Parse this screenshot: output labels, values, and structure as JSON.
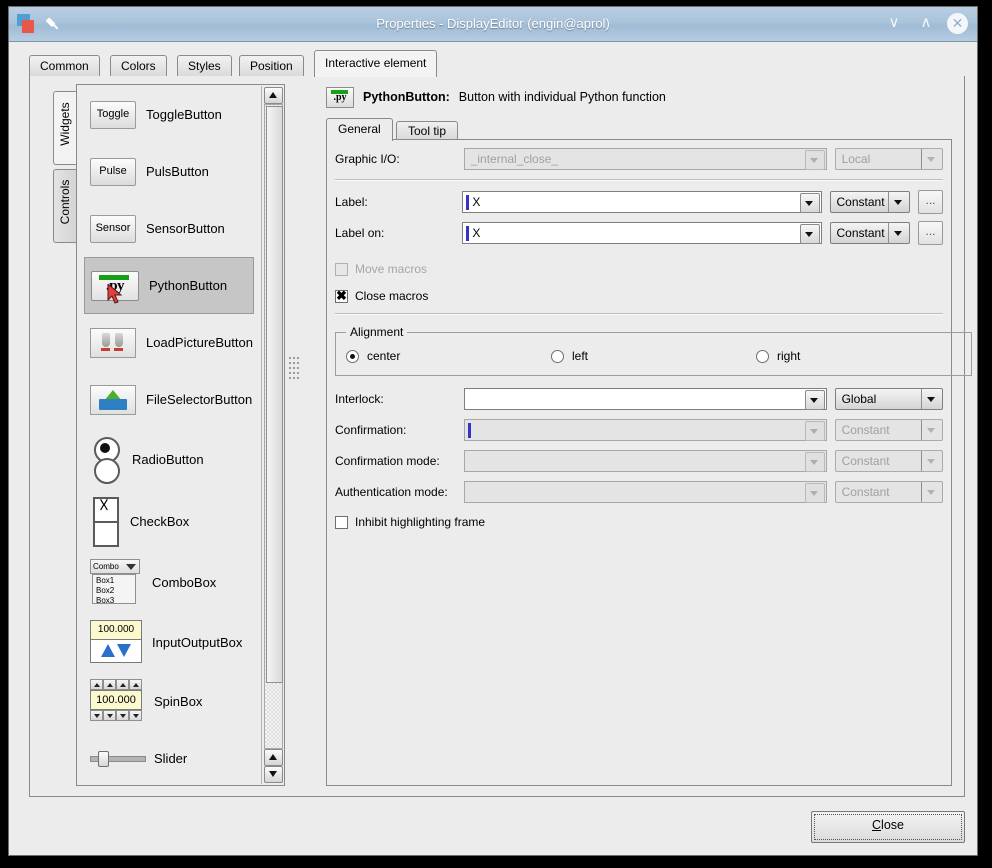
{
  "window": {
    "title": "Properties - DisplayEditor (engin@aprol)",
    "icons": {
      "app": "app-icon",
      "pin": "pin-icon",
      "minimize": "∨",
      "maximize": "∧",
      "close": "✕"
    }
  },
  "outer_tabs": [
    {
      "label": "Common",
      "selected": false
    },
    {
      "label": "Colors",
      "selected": false
    },
    {
      "label": "Styles",
      "selected": false
    },
    {
      "label": "Position",
      "selected": false
    },
    {
      "label": "Interactive element",
      "selected": true
    }
  ],
  "side_tabs": [
    {
      "label": "Widgets",
      "selected": true
    },
    {
      "label": "Controls",
      "selected": false
    }
  ],
  "widget_list": [
    {
      "name": "ToggleButton",
      "icon": "toggle-button-icon",
      "icon_text": "Toggle",
      "selected": false
    },
    {
      "name": "PulsButton",
      "icon": "pulse-button-icon",
      "icon_text": "Pulse",
      "selected": false
    },
    {
      "name": "SensorButton",
      "icon": "sensor-button-icon",
      "icon_text": "Sensor",
      "selected": false
    },
    {
      "name": "PythonButton",
      "icon": "python-button-icon",
      "icon_text": ".py",
      "selected": true
    },
    {
      "name": "LoadPictureButton",
      "icon": "load-picture-button-icon",
      "icon_text": "",
      "selected": false
    },
    {
      "name": "FileSelectorButton",
      "icon": "file-selector-button-icon",
      "icon_text": "",
      "selected": false
    },
    {
      "name": "RadioButton",
      "icon": "radio-button-icon",
      "icon_text": "",
      "selected": false
    },
    {
      "name": "CheckBox",
      "icon": "checkbox-icon",
      "icon_text": "",
      "selected": false
    },
    {
      "name": "ComboBox",
      "icon": "combobox-icon",
      "icon_text": "Combo",
      "selected": false
    },
    {
      "name": "InputOutputBox",
      "icon": "inputoutputbox-icon",
      "icon_text": "100.000",
      "selected": false
    },
    {
      "name": "SpinBox",
      "icon": "spinbox-icon",
      "icon_text": "100.000",
      "selected": false
    },
    {
      "name": "Slider",
      "icon": "slider-icon",
      "icon_text": "",
      "selected": false
    }
  ],
  "combobox_items": [
    "Box1",
    "Box2",
    "Box3"
  ],
  "header": {
    "icon": "python-button-icon",
    "icon_text": ".py",
    "name": "PythonButton:",
    "description": "Button with individual Python function"
  },
  "inner_tabs": [
    {
      "label": "General",
      "selected": true
    },
    {
      "label": "Tool tip",
      "selected": false
    }
  ],
  "form": {
    "graphic_io": {
      "label": "Graphic I/O:",
      "value": "_internal_close_",
      "scope": "Local",
      "disabled": true
    },
    "label_field": {
      "label": "Label:",
      "value": "X",
      "mode": "Constant",
      "browse": "..."
    },
    "label_on_field": {
      "label": "Label on:",
      "value": "X",
      "mode": "Constant",
      "browse": "..."
    },
    "move_macros": {
      "label": "Move macros",
      "checked": false,
      "disabled": true,
      "mark": ""
    },
    "close_macros": {
      "label": "Close macros",
      "checked": true,
      "disabled": false,
      "mark": "✖"
    },
    "alignment": {
      "legend": "Alignment",
      "options": [
        {
          "label": "center",
          "selected": true
        },
        {
          "label": "left",
          "selected": false
        },
        {
          "label": "right",
          "selected": false
        }
      ]
    },
    "interlock": {
      "label": "Interlock:",
      "value": "",
      "mode": "Global",
      "disabled": false
    },
    "confirmation": {
      "label": "Confirmation:",
      "value": "",
      "mode": "Constant",
      "disabled": true
    },
    "confirmation_mode": {
      "label": "Confirmation mode:",
      "value": "",
      "mode": "Constant",
      "disabled": true
    },
    "authentication_mode": {
      "label": "Authentication mode:",
      "value": "",
      "mode": "Constant",
      "disabled": true
    },
    "inhibit_highlighting": {
      "label": "Inhibit highlighting frame",
      "checked": false
    }
  },
  "footer": {
    "close_label": "Close",
    "close_mnemonic": "C"
  },
  "colors": {
    "window_bg": "#ececec",
    "titlebar": "#a9c3da",
    "selection": "#c6c6c6",
    "cursor": "#3333cc",
    "python_green": "#17a017",
    "field_yellow": "#fbf9cd"
  }
}
